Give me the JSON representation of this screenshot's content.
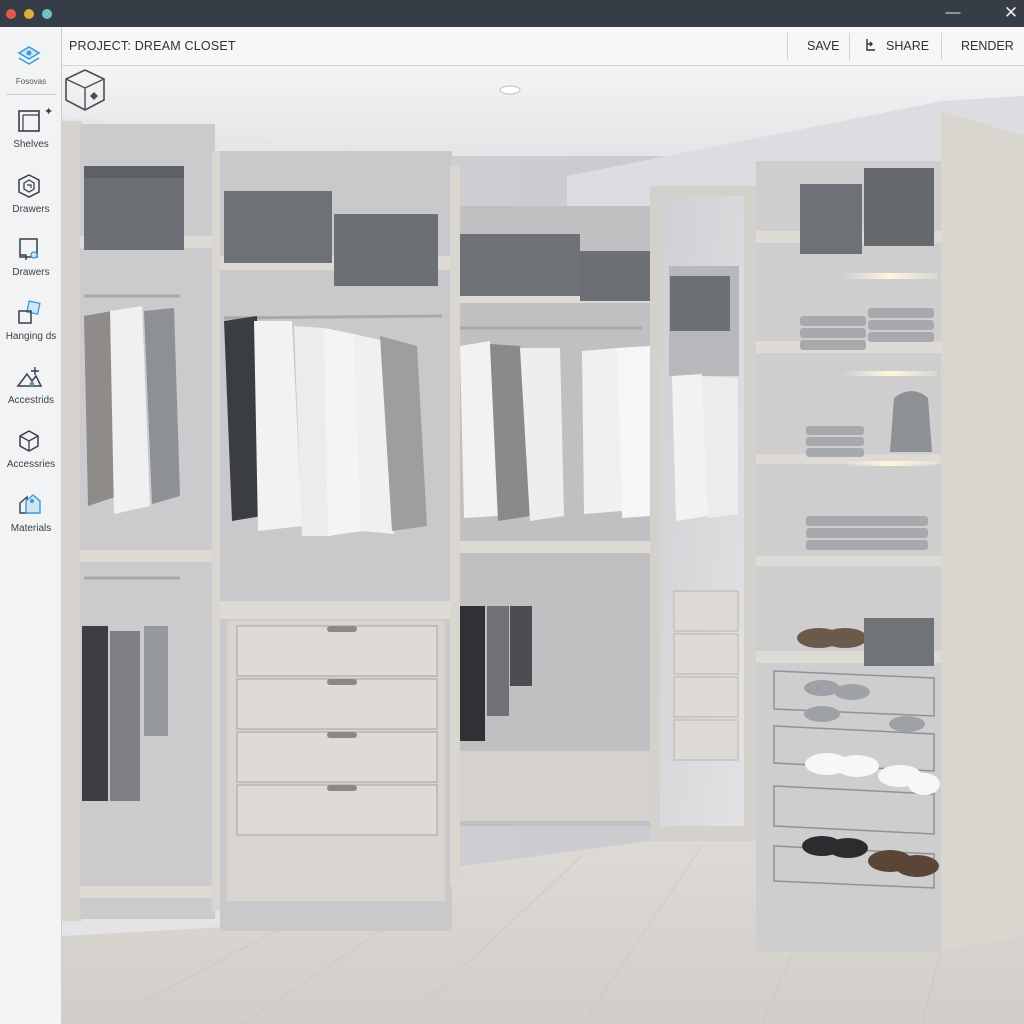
{
  "window": {
    "minimize_glyph": "—",
    "close_glyph": "✕"
  },
  "toolbar": {
    "project_title": "PROJECT: DREAM CLOSET",
    "save_label": "SAVE",
    "share_label": "SHARE",
    "render_label": "RENDER"
  },
  "sidebar": {
    "top_item": {
      "label": "Fosovas",
      "icon": "layers-icon"
    },
    "items": [
      {
        "label": "Shelves",
        "icon": "shelf-icon"
      },
      {
        "label": "Drawers",
        "icon": "drawer-box-icon"
      },
      {
        "label": "Drawers",
        "icon": "drawer-icon"
      },
      {
        "label": "Hanging ds",
        "icon": "hanging-icon"
      },
      {
        "label": "Accestrids",
        "icon": "accessories-icon"
      },
      {
        "label": "Accessries",
        "icon": "cube-icon"
      },
      {
        "label": "Materials",
        "icon": "materials-icon"
      }
    ]
  },
  "colors": {
    "accent": "#3a9bd5",
    "wood": "#dcd8d3",
    "storage_box": "#6c6f73"
  }
}
